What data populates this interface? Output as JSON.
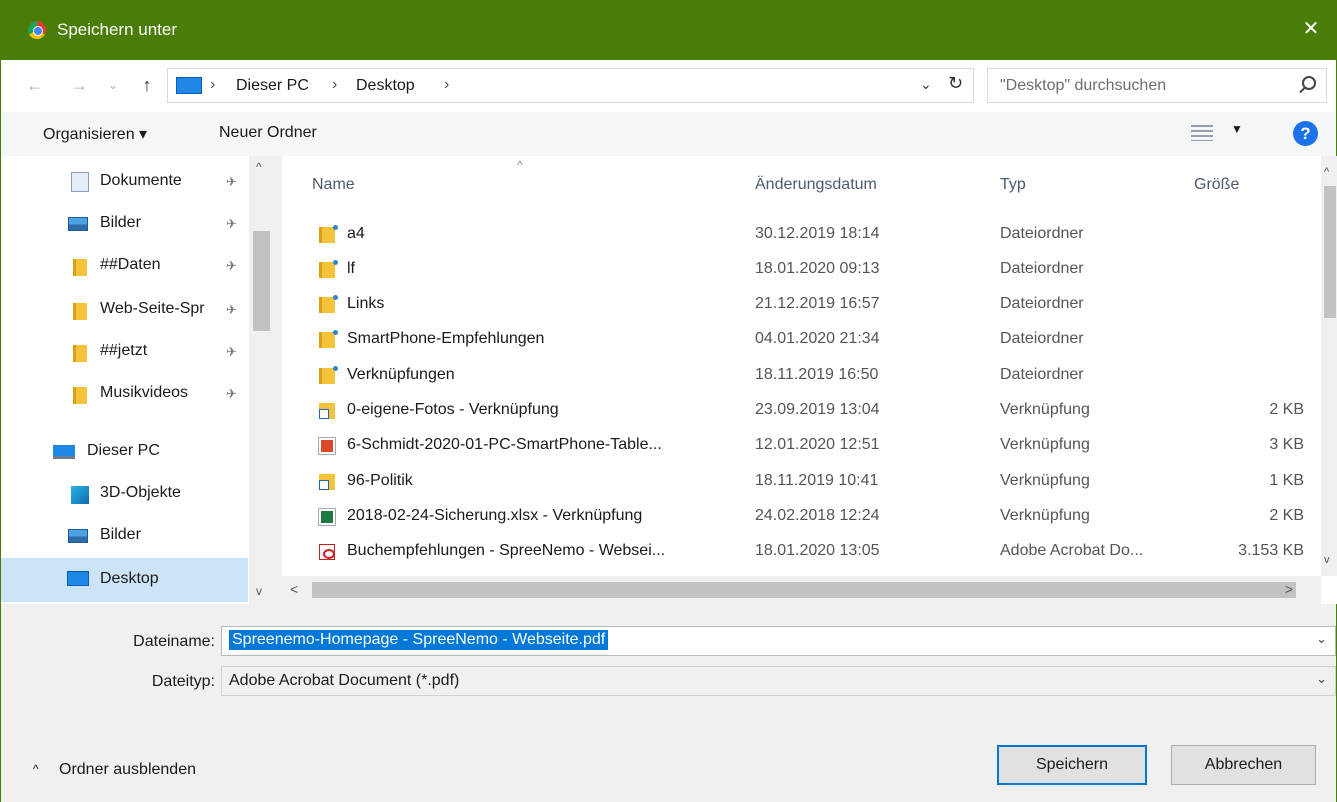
{
  "window": {
    "title": "Speichern unter",
    "close": "✕"
  },
  "nav_buttons": {
    "back": "←",
    "forward": "→",
    "recent": "⌄",
    "up": "↑"
  },
  "address": {
    "crumbs": [
      "Dieser PC",
      "Desktop"
    ],
    "sep": "›",
    "dropdown": "⌄",
    "refresh": "↻"
  },
  "search": {
    "placeholder": "\"Desktop\" durchsuchen"
  },
  "toolbar": {
    "organize": "Organisieren ▾",
    "new_folder": "Neuer Ordner",
    "view_dropdown": "▼",
    "help": "?"
  },
  "navpane": {
    "items": [
      {
        "label": "Dokumente",
        "icon": "documents-icon",
        "pinned": true
      },
      {
        "label": "Bilder",
        "icon": "pictures-icon",
        "pinned": true
      },
      {
        "label": "##Daten",
        "icon": "folder-icon",
        "pinned": true
      },
      {
        "label": "Web-Seite-Spr",
        "icon": "folder-icon",
        "pinned": true
      },
      {
        "label": "##jetzt",
        "icon": "folder-icon",
        "pinned": true
      },
      {
        "label": "Musikvideos",
        "icon": "folder-icon",
        "pinned": true
      },
      {
        "label": "Dieser PC",
        "icon": "this-pc-icon",
        "pinned": false
      },
      {
        "label": "3D-Objekte",
        "icon": "3d-objects-icon",
        "pinned": false
      },
      {
        "label": "Bilder",
        "icon": "pictures-icon",
        "pinned": false
      },
      {
        "label": "Desktop",
        "icon": "desktop-icon",
        "pinned": false,
        "selected": true
      }
    ],
    "pin_glyph": "✈",
    "scroll_up": "^",
    "scroll_down": "v"
  },
  "filelist": {
    "sort_glyph": "^",
    "columns": {
      "name": "Name",
      "date": "Änderungsdatum",
      "type": "Typ",
      "size": "Größe"
    },
    "rows": [
      {
        "name": "a4",
        "date": "30.12.2019 18:14",
        "type": "Dateiordner",
        "size": "",
        "icon": "folder-icon"
      },
      {
        "name": "lf",
        "date": "18.01.2020 09:13",
        "type": "Dateiordner",
        "size": "",
        "icon": "folder-icon"
      },
      {
        "name": "Links",
        "date": "21.12.2019 16:57",
        "type": "Dateiordner",
        "size": "",
        "icon": "folder-icon"
      },
      {
        "name": "SmartPhone-Empfehlungen",
        "date": "04.01.2020 21:34",
        "type": "Dateiordner",
        "size": "",
        "icon": "folder-icon"
      },
      {
        "name": "Verknüpfungen",
        "date": "18.11.2019 16:50",
        "type": "Dateiordner",
        "size": "",
        "icon": "folder-icon"
      },
      {
        "name": "0-eigene-Fotos - Verknüpfung",
        "date": "23.09.2019 13:04",
        "type": "Verknüpfung",
        "size": "2 KB",
        "icon": "shortcut-icon"
      },
      {
        "name": "6-Schmidt-2020-01-PC-SmartPhone-Table...",
        "date": "12.01.2020 12:51",
        "type": "Verknüpfung",
        "size": "3 KB",
        "icon": "powerpoint-icon"
      },
      {
        "name": "96-Politik",
        "date": "18.11.2019 10:41",
        "type": "Verknüpfung",
        "size": "1 KB",
        "icon": "shortcut-icon"
      },
      {
        "name": "2018-02-24-Sicherung.xlsx - Verknüpfung",
        "date": "24.02.2018 12:24",
        "type": "Verknüpfung",
        "size": "2 KB",
        "icon": "excel-icon"
      },
      {
        "name": "Buchempfehlungen - SpreeNemo - Websei...",
        "date": "18.01.2020 13:05",
        "type": "Adobe Acrobat Do...",
        "size": "3.153 KB",
        "icon": "pdf-icon"
      }
    ],
    "scroll": {
      "up": "^",
      "down": "v",
      "left": "<",
      "right": ">"
    }
  },
  "filename": {
    "label": "Dateiname:",
    "value": "Spreenemo-Homepage - SpreeNemo - Webseite.pdf",
    "dropdown": "⌄"
  },
  "filetype": {
    "label": "Dateityp:",
    "value": "Adobe Acrobat Document (*.pdf)",
    "dropdown": "⌄"
  },
  "footer": {
    "hide_folders": "Ordner ausblenden",
    "chevron": "^",
    "save": "Speichern",
    "cancel": "Abbrechen"
  },
  "colors": {
    "titlebar": "#4a7d08",
    "selection": "#0078d7",
    "nav_selected": "#cce4f7"
  }
}
